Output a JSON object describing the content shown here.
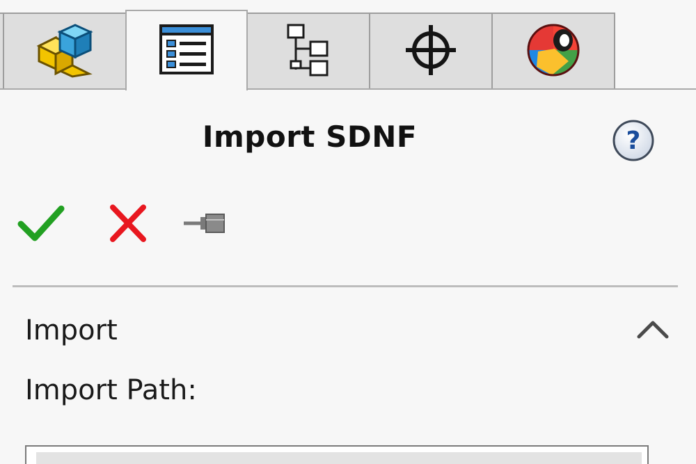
{
  "tabs": [
    {
      "id": "feature-manager",
      "icon": "part-cube-icon",
      "active": false
    },
    {
      "id": "property-manager",
      "icon": "property-list-icon",
      "active": true
    },
    {
      "id": "configuration-manager",
      "icon": "tree-hierarchy-icon",
      "active": false
    },
    {
      "id": "dimxpert-manager",
      "icon": "crosshair-icon",
      "active": false
    },
    {
      "id": "display-manager",
      "icon": "color-sphere-icon",
      "active": false
    }
  ],
  "header": {
    "title": "Import SDNF",
    "help_icon": "question-mark-icon"
  },
  "actions": {
    "ok_icon": "checkmark-icon",
    "cancel_icon": "x-icon",
    "pin_icon": "pushpin-icon"
  },
  "section": {
    "title": "Import",
    "collapse_icon": "chevron-up-icon",
    "field_label": "Import Path:",
    "path_value": ""
  },
  "colors": {
    "ok_green": "#22a022",
    "cancel_red": "#e8171f",
    "pin_gray": "#7a7a7a",
    "tab_inactive": "#dedede",
    "panel_bg": "#f7f7f7"
  }
}
